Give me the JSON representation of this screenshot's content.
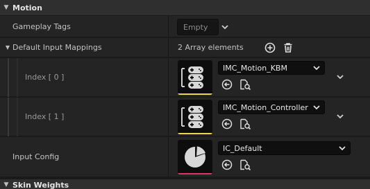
{
  "categories": {
    "motion": "Motion",
    "skin_weights": "Skin Weights"
  },
  "gameplay_tags": {
    "label": "Gameplay Tags",
    "value": "Empty"
  },
  "default_input_mappings": {
    "label": "Default Input Mappings",
    "count_text": "2 Array elements",
    "elements": [
      {
        "index_label": "Index [ 0 ]",
        "asset": "IMC_Motion_KBM",
        "thumb_color": "#e6d94a"
      },
      {
        "index_label": "Index [ 1 ]",
        "asset": "IMC_Motion_Controller",
        "thumb_color": "#e6d94a"
      }
    ]
  },
  "input_config": {
    "label": "Input Config",
    "asset": "IC_Default",
    "thumb_color": "#d43a6a"
  },
  "colors": {
    "background": "#1a1a1a",
    "row": "#242424",
    "header": "#2f2f2f",
    "mapping_underline": "#e6d94a",
    "config_underline": "#d43a6a"
  }
}
